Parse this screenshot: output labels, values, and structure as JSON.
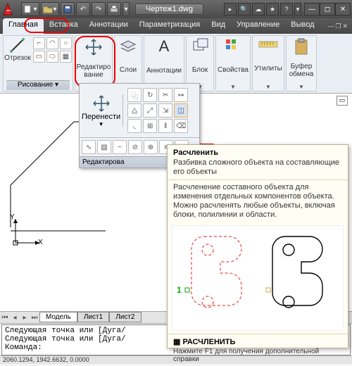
{
  "title": "Чертеж1.dwg",
  "menubar": [
    "Главная",
    "Вставка",
    "Аннотации",
    "Параметризация",
    "Вид",
    "Управление",
    "Вывод"
  ],
  "ribbon": {
    "segment": {
      "label": "Отрезок"
    },
    "drawing_panel": "Рисование",
    "edit": {
      "label": "Редактиро\nвание"
    },
    "layers": {
      "label": "Слои"
    },
    "annot": {
      "label": "Аннотации"
    },
    "block": {
      "label": "Блок"
    },
    "props": {
      "label": "Свойства"
    },
    "utils": {
      "label": "Утилиты"
    },
    "clip": {
      "label": "Буфер\nобмена"
    }
  },
  "flyout": {
    "move": "Перенести",
    "footer": "Редактирова"
  },
  "tooltip": {
    "title": "Расчленить",
    "subtitle": "Разбивка сложного объекта на составляющие его объекты",
    "body": "Расчленение составного объекта для изменения отдельных компонентов объекта. Можно расчленять любые объекты, включая блоки, полилинии и области.",
    "cmd": "РАСЧЛЕНИТЬ",
    "help": "Нажмите F1 для получения дополнительной справки",
    "marker": "1"
  },
  "tabs": {
    "model": "Модель",
    "sheet1": "Лист1",
    "sheet2": "Лист2"
  },
  "cmd": {
    "l1": "Следующая точка или [Дуга/",
    "l2": "Следующая точка или [Дуга/",
    "prompt": "Команда:"
  },
  "status": "2060.1294, 1942.6632, 0.0000",
  "axes": {
    "x": "X",
    "y": "Y"
  }
}
